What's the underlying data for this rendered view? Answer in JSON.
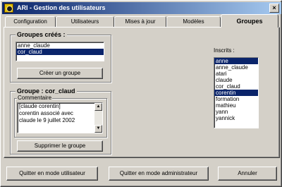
{
  "window": {
    "title": "ARI - Gestion des utilisateurs",
    "close_glyph": "×"
  },
  "tabs": [
    {
      "label": "Configuration"
    },
    {
      "label": "Utilisateurs"
    },
    {
      "label": "Mises à jour"
    },
    {
      "label": "Modèles"
    },
    {
      "label": "Groupes"
    }
  ],
  "groupes_crees": {
    "label": "Groupes créés :",
    "items": [
      {
        "label": "anne_claude",
        "selected": false
      },
      {
        "label": "cor_claud",
        "selected": true
      }
    ],
    "create_button": "Créer un groupe"
  },
  "groupe_detail": {
    "label": "Groupe : cor_claud",
    "comment_label": "Commentaire",
    "comment_lines": [
      "[claude corentin]",
      "corentin associé avec",
      "claude le 9 juillet 2002"
    ],
    "delete_button": "Supprimer le groupe"
  },
  "inscrits": {
    "label": "Inscrits :",
    "items": [
      {
        "label": "anne",
        "selected": true
      },
      {
        "label": "anne_claude",
        "selected": false
      },
      {
        "label": "atari",
        "selected": false
      },
      {
        "label": "claude",
        "selected": false
      },
      {
        "label": "cor_claud",
        "selected": false
      },
      {
        "label": "corentin",
        "selected": true
      },
      {
        "label": "formation",
        "selected": false
      },
      {
        "label": "mathieu",
        "selected": false
      },
      {
        "label": "yann",
        "selected": false
      },
      {
        "label": "yannick",
        "selected": false
      }
    ]
  },
  "footer": {
    "quit_user": "Quitter en mode utilisateur",
    "quit_admin": "Quitter en mode administrateur",
    "cancel": "Annuler"
  },
  "scroll": {
    "up_glyph": "▲",
    "down_glyph": "▼"
  },
  "colors": {
    "selection": "#0a246a",
    "face": "#d4d0c8",
    "titlebar": "#0a246a"
  }
}
